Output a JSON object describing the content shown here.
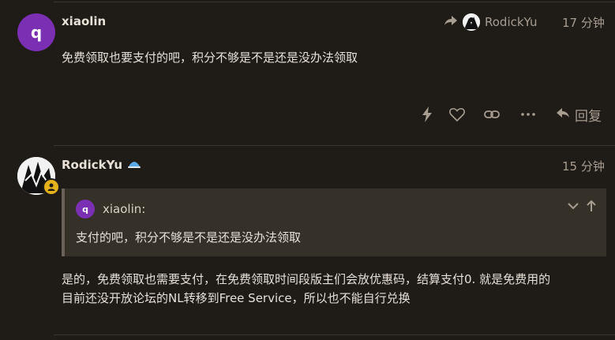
{
  "post1": {
    "avatar_letter": "q",
    "username": "xiaolin",
    "reply_to_user": "RodickYu",
    "timestamp": "17 分钟",
    "body": "免费领取也要支付的吧，积分不够是不是还是没办法领取",
    "reply_label": "回复"
  },
  "post2": {
    "username": "RodickYu",
    "timestamp": "15 分钟",
    "quote": {
      "avatar_letter": "q",
      "username": "xiaolin:",
      "text": "支付的吧，积分不够是不是还是没办法领取"
    },
    "body_line1": "是的，免费领取也需要支付，在免费领取时间段版主们会放优惠码，结算支付0. 就是免费用的",
    "body_line2": "目前还没开放论坛的NL转移到Free Service，所以也不能自行兑换"
  },
  "colors": {
    "background": "#1f1b16",
    "avatar_purple": "#7b2fb3",
    "muted_text": "#a89d91",
    "quote_bg": "#353129",
    "badge_yellow": "#e4b31b"
  }
}
